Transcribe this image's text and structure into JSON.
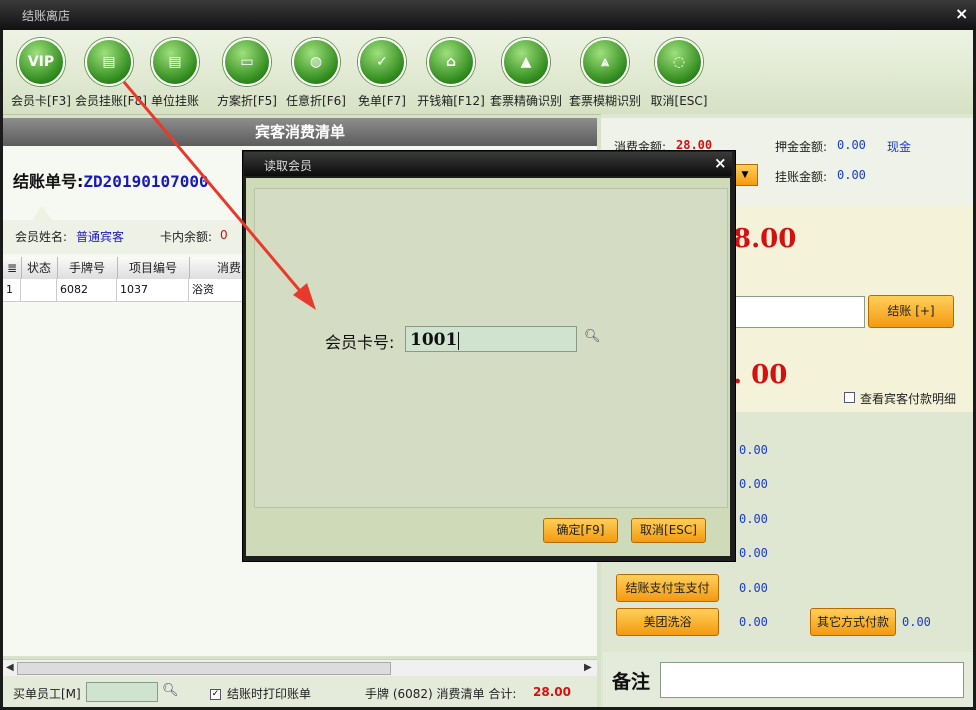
{
  "window": {
    "title": "结账离店",
    "close": "×"
  },
  "toolbar": {
    "items": [
      {
        "label": "会员卡[F3]",
        "glyph": "VIP"
      },
      {
        "label": "会员挂账[F8]",
        "glyph": "▤"
      },
      {
        "label": "单位挂账",
        "glyph": "▤"
      },
      {
        "label": "方案折[F5]",
        "glyph": "▭"
      },
      {
        "label": "任意折[F6]",
        "glyph": "◍"
      },
      {
        "label": "免单[F7]",
        "glyph": "✓"
      },
      {
        "label": "开钱箱[F12]",
        "glyph": "⌂"
      },
      {
        "label": "套票精确识别",
        "glyph": "▲"
      },
      {
        "label": "套票模糊识别",
        "glyph": "⩓"
      },
      {
        "label": "取消[ESC]",
        "glyph": "◌"
      }
    ]
  },
  "left": {
    "header": "宾客消费清单",
    "bill_label": "结账单号:",
    "bill_no": "ZD20190107000",
    "member_name_label": "会员姓名:",
    "member_name": "普通宾客",
    "card_balance_label": "卡内余额:",
    "card_balance": "0",
    "table": {
      "headers": [
        "状态",
        "手牌号",
        "项目编号",
        "消费"
      ],
      "rows": [
        {
          "idx": "1",
          "status": "",
          "tag": "6082",
          "code": "1037",
          "item": "浴资"
        }
      ]
    }
  },
  "bottom": {
    "staff_label": "买单员工[M]",
    "print_label": "结账时打印账单",
    "summary_prefix": "手牌 (6082) 消费清单 合计:",
    "summary_total": "28.00"
  },
  "right": {
    "consume_label": "消费金额:",
    "consume_value": "28.00",
    "deposit_label": "押金金额:",
    "deposit_value": "0.00",
    "cash_label": "现金",
    "credit_label": "挂账金额:",
    "credit_value": "0.00",
    "big_amount_1": "8.00",
    "settle_button": "结账 [+]",
    "big_amount_2": ". 00",
    "view_detail_label": "查看宾客付款明细",
    "pay_values": [
      "0.00",
      "0.00",
      "0.00",
      "0.00",
      "0.00"
    ],
    "alipay_button": "结账支付宝支付",
    "meituan_button": "美团洗浴",
    "meituan_value": "0.00",
    "other_pay_button": "其它方式付款",
    "other_pay_value": "0.00",
    "remark_label": "备注"
  },
  "dialog": {
    "title": "读取会员",
    "close": "×",
    "card_label": "会员卡号:",
    "card_value": "1001",
    "ok_button": "确定[F9]",
    "cancel_button": "取消[ESC]"
  },
  "colors": {
    "accent_red": "#d41010",
    "link_blue": "#1a3cc8",
    "button_orange": "#f39a10",
    "arrow_red": "#e83a2a"
  }
}
